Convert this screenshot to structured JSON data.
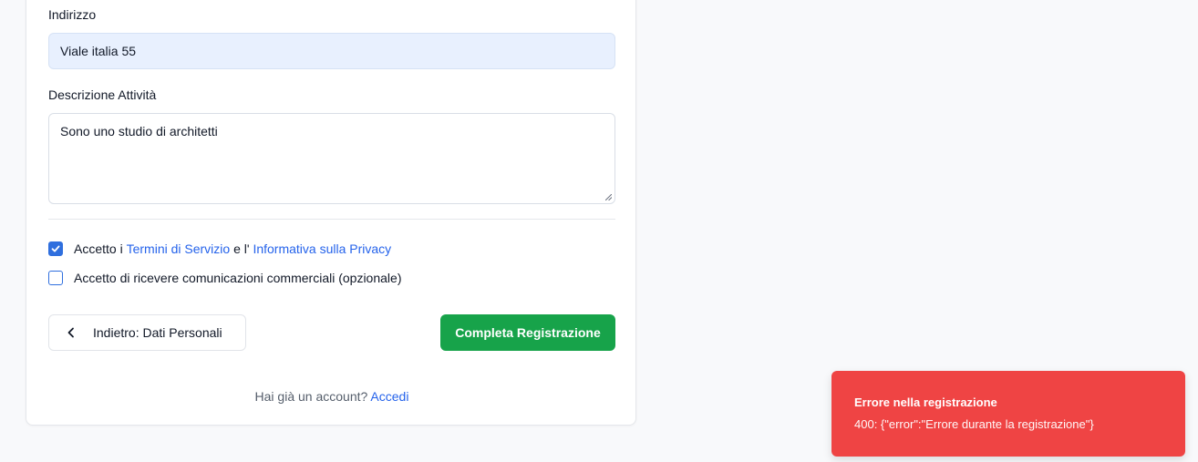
{
  "form": {
    "address_label": "Indirizzo",
    "address_value": "Viale italia 55",
    "description_label": "Descrizione Attività",
    "description_value": "Sono uno studio di architetti",
    "terms": {
      "checked": true,
      "prefix": "Accetto i ",
      "terms_link": "Termini di Servizio",
      "middle": " e l' ",
      "privacy_link": "Informativa sulla Privacy"
    },
    "marketing": {
      "checked": false,
      "label": "Accetto di ricevere comunicazioni commerciali (opzionale)"
    },
    "back_button": "Indietro: Dati Personali",
    "submit_button": "Completa Registrazione",
    "login_prompt": "Hai già un account?",
    "login_link": "Accedi"
  },
  "toast": {
    "title": "Errore nella registrazione",
    "message": "400: {\"error\":\"Errore durante la registrazione\"}"
  },
  "icons": {
    "checkbox_checked": "check-icon",
    "back": "chevron-left-icon",
    "resize": "resize-handle-icon"
  },
  "colors": {
    "accent": "#2563eb",
    "submit": "#17a34a",
    "error": "#ef4444",
    "address_fill": "#e8f0fe"
  }
}
